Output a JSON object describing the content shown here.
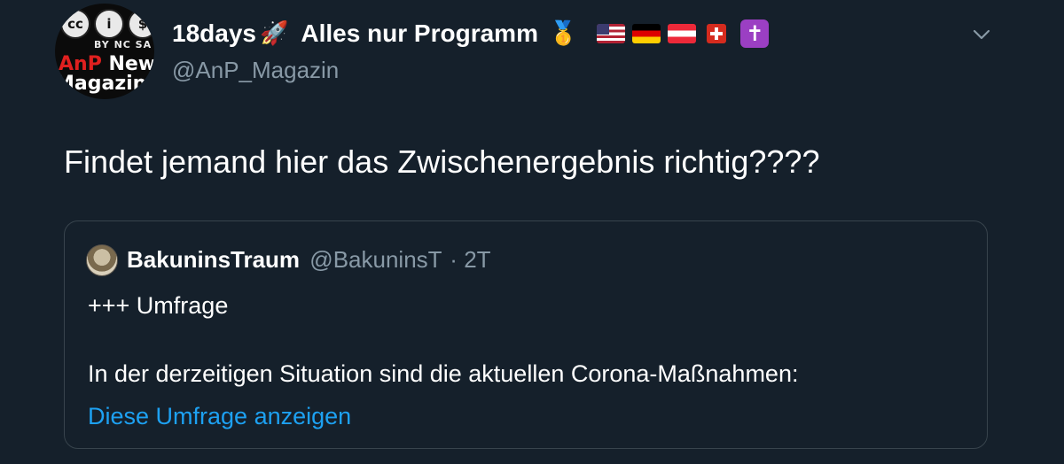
{
  "tweet": {
    "avatar": {
      "cc_symbols": [
        "cc",
        "i",
        "$"
      ],
      "cc_text": "BY NC SA",
      "logo_accent": "AnP",
      "logo_line1_rest": " News",
      "logo_line2": "Magazin"
    },
    "display_name": "18days",
    "rocket_emoji": "🚀",
    "display_name_suffix": "Alles nur Programm",
    "medal_emoji": "🥇",
    "flags": [
      "us-flag",
      "germany-flag",
      "austria-flag",
      "switzerland-flag"
    ],
    "cross_symbol": "✝",
    "handle": "@AnP_Magazin",
    "menu_icon": "chevron-down-icon",
    "text": "Findet jemand hier das Zwischenergebnis richtig????"
  },
  "quoted_tweet": {
    "name": "BakuninsTraum",
    "handle": "@BakuninsT",
    "separator": "·",
    "time": "2T",
    "line1": "+++ Umfrage",
    "line2": "In der derzeitigen Situation sind die aktuellen Corona-Maßnahmen:",
    "poll_link": "Diese Umfrage anzeigen"
  },
  "colors": {
    "background": "#15202b",
    "text_primary": "#ffffff",
    "text_secondary": "#8899a6",
    "link": "#1da1f2",
    "border": "#38444d"
  }
}
